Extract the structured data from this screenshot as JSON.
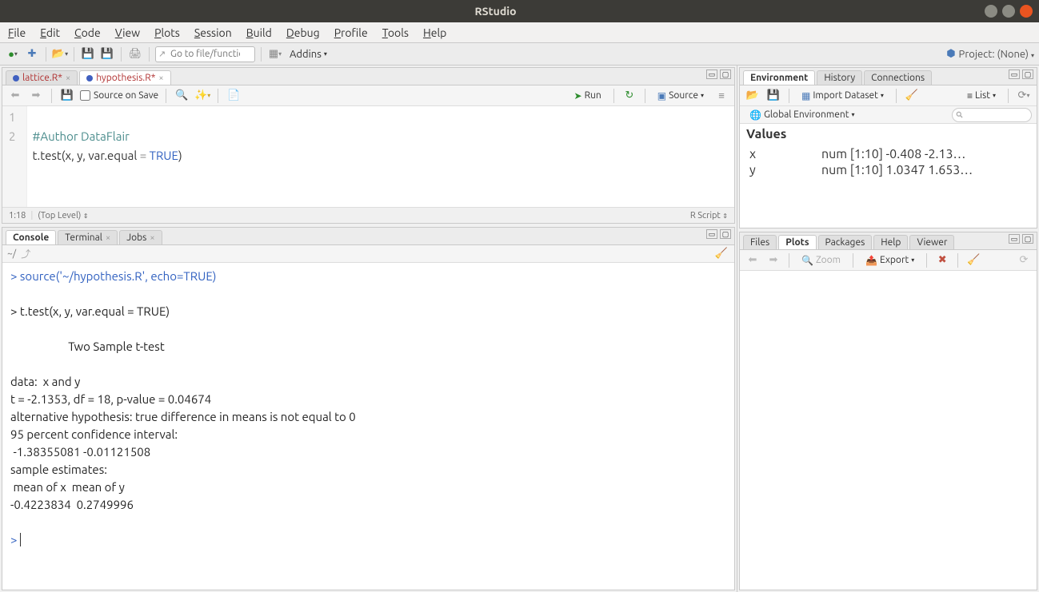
{
  "window": {
    "title": "RStudio"
  },
  "menu": {
    "file": "File",
    "edit": "Edit",
    "code": "Code",
    "view": "View",
    "plots": "Plots",
    "session": "Session",
    "build": "Build",
    "debug": "Debug",
    "profile": "Profile",
    "tools": "Tools",
    "help": "Help"
  },
  "toolbar": {
    "goto_placeholder": "Go to file/function",
    "addins": "Addins",
    "project": "Project: (None)"
  },
  "source": {
    "tabs": [
      {
        "name": "lattice.R*",
        "modified": true
      },
      {
        "name": "hypothesis.R*",
        "modified": true
      }
    ],
    "active_tab": 1,
    "toolbar": {
      "source_on_save": "Source on Save",
      "run": "Run",
      "source_btn": "Source"
    },
    "lines": [
      {
        "n": "1",
        "raw": "#Author DataFlair",
        "html_class": "comment"
      },
      {
        "n": "2",
        "raw": "t.test(x, y, var.equal = TRUE)"
      }
    ],
    "status": {
      "pos": "1:18",
      "scope": "(Top Level)",
      "type": "R Script"
    }
  },
  "console": {
    "tabs": {
      "console": "Console",
      "terminal": "Terminal",
      "jobs": "Jobs"
    },
    "path": "~/",
    "output_cmd": "source('~/hypothesis.R', echo=TRUE)",
    "output_cmd2": "> t.test(x, y, var.equal = TRUE)",
    "output_body": "\n\tTwo Sample t-test\n\ndata:  x and y\nt = -2.1353, df = 18, p-value = 0.04674\nalternative hypothesis: true difference in means is not equal to 0\n95 percent confidence interval:\n -1.38355081 -0.01121508\nsample estimates:\n mean of x  mean of y \n-0.4223834  0.2749996 \n"
  },
  "env": {
    "tabs": {
      "environment": "Environment",
      "history": "History",
      "connections": "Connections"
    },
    "toolbar": {
      "import": "Import Dataset",
      "list": "List",
      "scope": "Global Environment"
    },
    "section": "Values",
    "items": [
      {
        "name": "x",
        "value": "num [1:10] -0.408 -2.13…"
      },
      {
        "name": "y",
        "value": "num [1:10] 1.0347 1.653…"
      }
    ]
  },
  "plots": {
    "tabs": {
      "files": "Files",
      "plots": "Plots",
      "packages": "Packages",
      "help": "Help",
      "viewer": "Viewer"
    },
    "toolbar": {
      "zoom": "Zoom",
      "export": "Export"
    }
  }
}
